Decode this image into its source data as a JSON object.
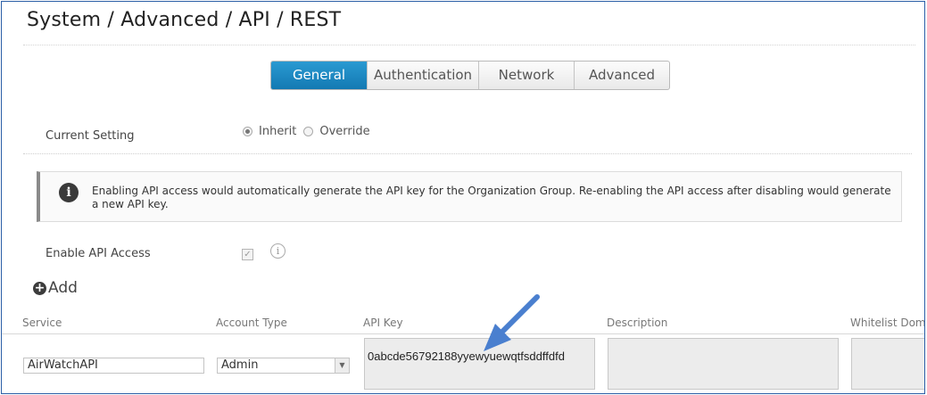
{
  "breadcrumb": "System / Advanced / API / REST",
  "tabs": [
    {
      "label": "General",
      "active": true
    },
    {
      "label": "Authentication",
      "active": false
    },
    {
      "label": "Network",
      "active": false
    },
    {
      "label": "Advanced",
      "active": false
    }
  ],
  "current_setting": {
    "label": "Current Setting",
    "options": [
      {
        "label": "Inherit",
        "selected": true
      },
      {
        "label": "Override",
        "selected": false
      }
    ]
  },
  "info_message": "Enabling API access would automatically generate the API key for the Organization Group. Re-enabling the API access after disabling would generate a new API key.",
  "enable_api_access": {
    "label": "Enable API Access",
    "checked": true
  },
  "add_label": "Add",
  "grid": {
    "columns": [
      "Service",
      "Account Type",
      "API Key",
      "Description",
      "Whitelist Doma"
    ],
    "row": {
      "service": "AirWatchAPI",
      "account_type": "Admin",
      "api_key": "0abcde56792188yyewyuewqtfsddffdfd",
      "description": "",
      "whitelist_domains": ""
    }
  },
  "colors": {
    "active_tab": "#1a86c2",
    "annotation_arrow": "#4a7fcf",
    "frame_border": "#2b5fa6"
  },
  "icons": {
    "info": "info-icon",
    "add": "plus-circle-icon",
    "help": "info-circle-icon",
    "select": "chevron-down-icon"
  }
}
